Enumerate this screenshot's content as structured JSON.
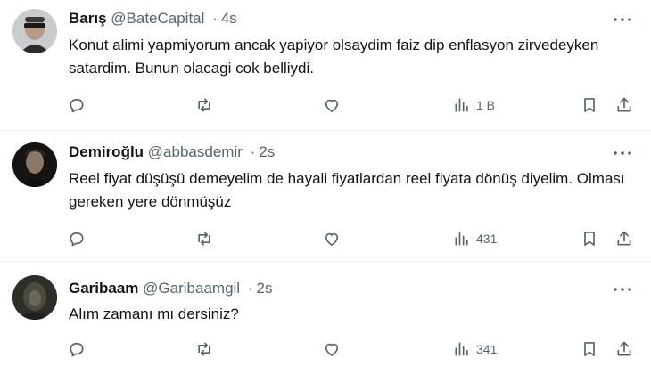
{
  "colors": {
    "text": "#0f1419",
    "secondary": "#536471",
    "divider": "#eff3f4",
    "background": "#ffffff"
  },
  "tweets": [
    {
      "name": "Barış",
      "handle": "@BateCapital",
      "dot": "·",
      "time": "4s",
      "text": "Konut alimi yapmiyorum ancak yapiyor olsaydim faiz dip enflasyon zirvedeyken satardim. Bunun olacagi cok belliydi.",
      "views": "1 B"
    },
    {
      "name": "Demiroğlu",
      "handle": "@abbasdemir",
      "dot": "·",
      "time": "2s",
      "text": "Reel fiyat düşüşü demeyelim de hayali fiyatlardan reel fiyata dönüş diyelim. Olması gereken yere dönmüşüz",
      "views": "431"
    },
    {
      "name": "Garibaam",
      "handle": "@Garibaamgil",
      "dot": "·",
      "time": "2s",
      "text": "Alım zamanı mı dersiniz?",
      "views": "341"
    }
  ],
  "icons": {
    "more": "more-dots-icon",
    "reply": "reply-icon",
    "retweet": "retweet-icon",
    "like": "heart-icon",
    "views": "views-chart-icon",
    "bookmark": "bookmark-icon",
    "share": "share-icon"
  }
}
